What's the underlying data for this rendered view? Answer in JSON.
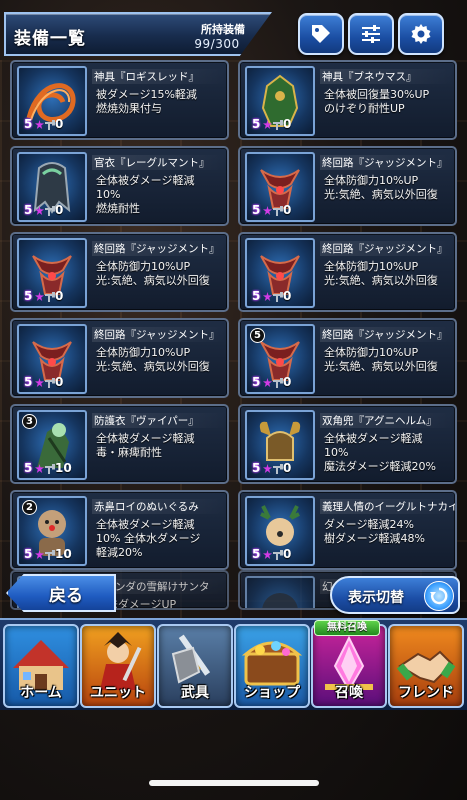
{
  "header": {
    "title": "装備一覧",
    "count_label": "所持装備",
    "count_value": "99/300",
    "buttons": [
      {
        "icon": "tag-icon"
      },
      {
        "icon": "sliders-icon"
      },
      {
        "icon": "gear-icon"
      }
    ]
  },
  "items": [
    {
      "name": "神具『ロギスレッド』",
      "effect": "被ダメージ15%軽減\n燃焼効果付与",
      "rarity": "5",
      "plus": "0",
      "art": "rope"
    },
    {
      "name": "神具『ブネウマス』",
      "effect": "全体被回復量30%UP\nのけぞり耐性UP",
      "rarity": "5",
      "plus": "0",
      "art": "armor"
    },
    {
      "name": "官衣『レーグルマント』",
      "effect": "全体被ダメージ軽減\n10%\n燃焼耐性",
      "rarity": "5",
      "plus": "0",
      "art": "cloak"
    },
    {
      "name": "終回路『ジャッジメント』",
      "effect": "全体防御力10%UP\n光:気絶、病気以外回復",
      "rarity": "5",
      "plus": "0",
      "art": "judgment"
    },
    {
      "name": "終回路『ジャッジメント』",
      "effect": "全体防御力10%UP\n光:気絶、病気以外回復",
      "rarity": "5",
      "plus": "0",
      "art": "judgment"
    },
    {
      "name": "終回路『ジャッジメント』",
      "effect": "全体防御力10%UP\n光:気絶、病気以外回復",
      "rarity": "5",
      "plus": "0",
      "art": "judgment"
    },
    {
      "name": "終回路『ジャッジメント』",
      "effect": "全体防御力10%UP\n光:気絶、病気以外回復",
      "rarity": "5",
      "plus": "0",
      "art": "judgment"
    },
    {
      "name": "終回路『ジャッジメント』",
      "effect": "全体防御力10%UP\n光:気絶、病気以外回復",
      "rarity": "5",
      "plus": "0",
      "art": "judgment",
      "badge": "5"
    },
    {
      "name": "防護衣『ヴァイパー』",
      "effect": "全体被ダメージ軽減\n毒・麻痺耐性",
      "rarity": "5",
      "plus": "10",
      "art": "viper",
      "badge": "3"
    },
    {
      "name": "双角兜『アグニヘルム』",
      "effect": "全体被ダメージ軽減\n10%\n魔法ダメージ軽減20%",
      "rarity": "5",
      "plus": "0",
      "art": "helm"
    },
    {
      "name": "赤鼻ロイのぬいぐるみ",
      "effect": "全体被ダメージ軽減\n10% 全体水ダメージ\n軽減20%",
      "rarity": "5",
      "plus": "10",
      "art": "doll",
      "badge": "2"
    },
    {
      "name": "義理人情のイーグルトナカイ",
      "effect": "ダメージ軽減24%\n樹ダメージ軽減48%",
      "rarity": "5",
      "plus": "0",
      "art": "reindeer"
    },
    {
      "name": "ミランダの雪解けサンタ",
      "effect": "魔法ダメージUP",
      "rarity": "",
      "plus": "",
      "art": "partial"
    },
    {
      "name": "幻",
      "effect": "",
      "rarity": "",
      "plus": "",
      "art": "partial"
    }
  ],
  "controls": {
    "back_label": "戻る",
    "toggle_label": "表示切替"
  },
  "nav": {
    "free_badge": "無料召喚",
    "items": [
      {
        "label": "ホーム",
        "icon": "home-icon"
      },
      {
        "label": "ユニット",
        "icon": "unit-icon"
      },
      {
        "label": "武具",
        "icon": "weapon-icon"
      },
      {
        "label": "ショップ",
        "icon": "shop-icon"
      },
      {
        "label": "召喚",
        "icon": "summon-icon"
      },
      {
        "label": "フレンド",
        "icon": "friend-icon"
      }
    ]
  },
  "colors": {
    "accent_blue": "#1f5bc0",
    "card_border": "#5c6e8a",
    "rarity_purple": "#d33be6"
  }
}
